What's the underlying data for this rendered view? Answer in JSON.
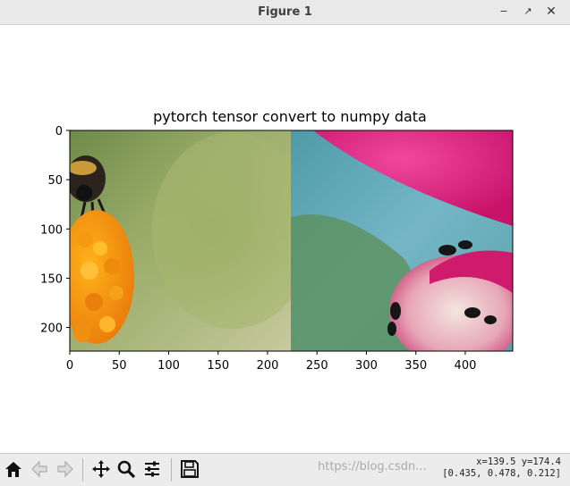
{
  "window": {
    "title": "Figure 1"
  },
  "chart_data": {
    "type": "image",
    "title": "pytorch tensor convert to numpy data",
    "xlabel": "",
    "ylabel": "",
    "x_ticks": [
      "0",
      "50",
      "100",
      "150",
      "200",
      "250",
      "300",
      "350",
      "400"
    ],
    "y_ticks": [
      "0",
      "50",
      "100",
      "150",
      "200"
    ],
    "image_width": 448,
    "image_height": 224,
    "grid": false
  },
  "toolbar": {
    "home": "home-icon",
    "back": "back-arrow-icon",
    "forward": "forward-arrow-icon",
    "pan": "pan-icon",
    "zoom": "zoom-icon",
    "configure": "configure-subplots-icon",
    "save": "save-icon"
  },
  "status": {
    "coords": "x=139.5 y=174.4",
    "pixel": "[0.435, 0.478, 0.212]"
  },
  "watermark": "https://blog.csdn..."
}
